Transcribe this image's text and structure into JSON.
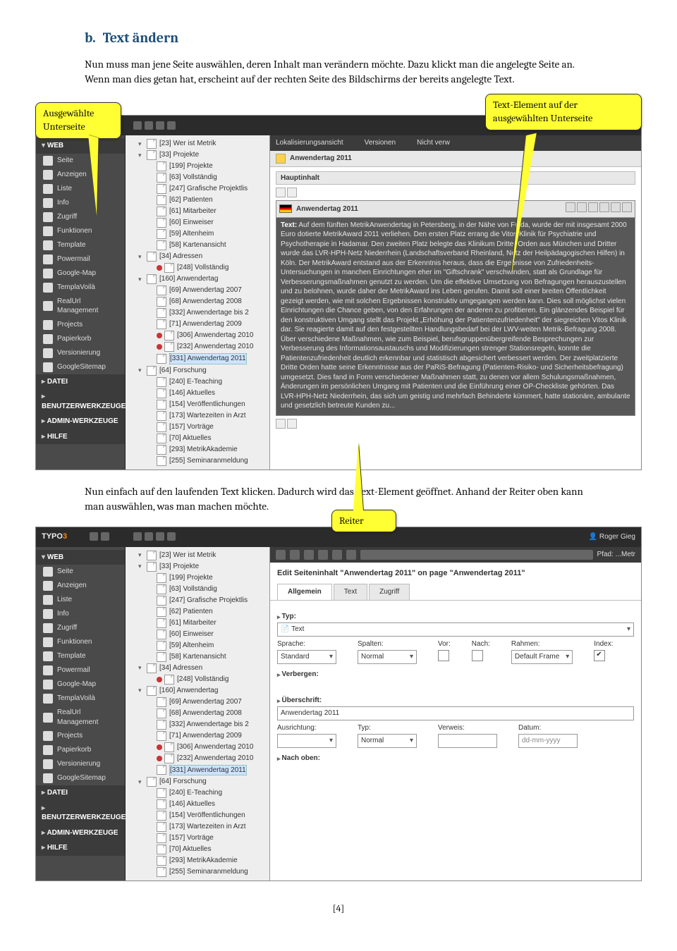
{
  "doc": {
    "heading_prefix": "b.",
    "heading": "Text ändern",
    "intro": "Nun muss man jene Seite auswählen, deren Inhalt man verändern möchte. Dazu klickt man die angelegte Seite an. Wenn man dies getan hat, erscheint auf der rechten Seite des Bildschirms der bereits angelegte Text.",
    "para2": "Nun einfach auf den laufenden Text klicken. Dadurch wird das Text-Element geöffnet. Anhand der Reiter oben kann man auswählen, was man machen möchte.",
    "page_num": "[4]"
  },
  "callouts": {
    "left": "Ausgewählte Unterseite",
    "right": "Text-Element auf der ausgewählten Unterseite",
    "reiter": "Reiter"
  },
  "shared": {
    "logo_a": "TYPO",
    "logo_b": "3",
    "user": "Roger Gieg",
    "web_group": "WEB",
    "modules": [
      "Seite",
      "Anzeigen",
      "Liste",
      "Info",
      "Zugriff",
      "Funktionen",
      "Template",
      "Powermail",
      "Google-Map",
      "TemplaVoilà",
      "RealUrl Management",
      "Projects",
      "Papierkorb",
      "Versionierung",
      "GoogleSitemap"
    ],
    "other_groups": [
      "DATEI",
      "BENUTZERWERKZEUGE",
      "ADMIN-WERKZEUGE",
      "HILFE"
    ],
    "tree": [
      {
        "lvl": 1,
        "exp": "▾",
        "lbl": "[23] Wer ist Metrik"
      },
      {
        "lvl": 1,
        "exp": "▾",
        "lbl": "[33] Projekte"
      },
      {
        "lvl": 2,
        "lbl": "[199] Projekte"
      },
      {
        "lvl": 2,
        "lbl": "[63] Vollständig"
      },
      {
        "lvl": 2,
        "lbl": "[247] Grafische Projektlis"
      },
      {
        "lvl": 2,
        "lbl": "[62] Patienten"
      },
      {
        "lvl": 2,
        "lbl": "[61] Mitarbeiter"
      },
      {
        "lvl": 2,
        "lbl": "[60] Einweiser"
      },
      {
        "lvl": 2,
        "lbl": "[59] Altenheim"
      },
      {
        "lvl": 2,
        "lbl": "[58] Kartenansicht"
      },
      {
        "lvl": 1,
        "exp": "▾",
        "lbl": "[34] Adressen"
      },
      {
        "lvl": 2,
        "dot": true,
        "lbl": "[248] Vollständig"
      },
      {
        "lvl": 1,
        "exp": "▾",
        "lbl": "[160] Anwendertag"
      },
      {
        "lvl": 2,
        "lbl": "[69] Anwendertag 2007"
      },
      {
        "lvl": 2,
        "lbl": "[68] Anwendertag 2008"
      },
      {
        "lvl": 2,
        "lbl": "[332] Anwendertage bis 2"
      },
      {
        "lvl": 2,
        "lbl": "[71] Anwendertag 2009"
      },
      {
        "lvl": 2,
        "dot": true,
        "lbl": "[306] Anwendertag 2010"
      },
      {
        "lvl": 2,
        "dot": true,
        "lbl": "[232] Anwendertag 2010"
      },
      {
        "lvl": 2,
        "sel": true,
        "lbl": "[331] Anwendertag 2011"
      },
      {
        "lvl": 1,
        "exp": "▾",
        "lbl": "[64] Forschung"
      },
      {
        "lvl": 2,
        "lbl": "[240] E-Teaching"
      },
      {
        "lvl": 2,
        "lbl": "[146] Aktuelles"
      },
      {
        "lvl": 2,
        "lbl": "[154] Veröffentlichungen"
      },
      {
        "lvl": 2,
        "lbl": "[173] Wartezeiten in Arzt"
      },
      {
        "lvl": 2,
        "lbl": "[157] Vorträge"
      },
      {
        "lvl": 2,
        "lbl": "[70] Aktuelles"
      },
      {
        "lvl": 2,
        "lbl": "[293] MetrikAkademie"
      },
      {
        "lvl": 2,
        "lbl": "[255] Seminaranmeldung"
      }
    ]
  },
  "fig1": {
    "path_tabs": [
      "Lokalisierungsansicht",
      "Versionen",
      "Nicht verw"
    ],
    "breadcrumb": "Anwendertag 2011",
    "maincol_header": "Hauptinhalt",
    "ce_title": "Anwendertag 2011",
    "ce_label": "Text:",
    "ce_text": "Auf dem fünften MetrikAnwendertag in Petersberg, in der Nähe von Fulda, wurde der mit insgesamt 2000 Euro dotierte MetrikAward 2011 verliehen. Den ersten Platz errang die Vitos Klinik für Psychiatrie und Psychotherapie in Hadamar. Den zweiten Platz belegte das Klinikum Dritter Orden aus München und Dritter wurde das LVR-HPH-Netz Niederrhein (Landschaftsverband Rheinland, Netz der Heilpädagogischen Hilfen) in Köln. Der MetrikAward entstand aus der Erkenntnis heraus, dass die Ergebnisse von Zufriedenheits-Untersuchungen in manchen Einrichtungen eher im \"Giftschrank\" verschwinden, statt als Grundlage für Verbesserungsmaßnahmen genutzt zu werden. Um die effektive Umsetzung von Befragungen herauszustellen und zu belohnen, wurde daher der MetrikAward ins Leben gerufen. Damit soll einer breiten Öffentlichkeit gezeigt werden, wie mit solchen Ergebnissen konstruktiv umgegangen werden kann. Dies soll möglichst vielen Einrichtungen die Chance geben, von den Erfahrungen der anderen zu profitieren. Ein glänzendes Beispiel für den konstruktiven Umgang stellt das Projekt „Erhöhung der Patientenzufriedenheit\" der siegreichen Vitos Klinik dar. Sie reagierte damit auf den festgestellten Handlungsbedarf bei der LWV-weiten Metrik-Befragung 2008. Über verschiedene Maßnahmen, wie zum Beispiel, berufsgruppenübergreifende Besprechungen zur Verbesserung des Informationsaustauschs und Modifizierungen strenger Stationsregeln, konnte die Patientenzufriedenheit deutlich erkennbar und statistisch abgesichert verbessert werden. Der zweitplatzierte Dritte Orden hatte seine Erkenntnisse aus der PaRiS-Befragung (Patienten-Risiko- und Sicherheitsbefragung) umgesetzt. Dies fand in Form verschiedener Maßnahmen statt, zu denen vor allem Schulungsmaßnahmen, Änderungen im persönlichen Umgang mit Patienten und die Einführung einer OP-Checkliste gehörten. Das LVR-HPH-Netz Niederrhein, das sich um geistig und mehrfach Behinderte kümmert, hatte stationäre, ambulante und gesetzlich betreute Kunden    zu..."
  },
  "fig2": {
    "pathlabel": "Pfad:  ...Metr",
    "edit_title": "Edit Seiteninhalt \"Anwendertag 2011\" on page \"Anwendertag 2011\"",
    "tabs": [
      "Allgemein",
      "Text",
      "Zugriff"
    ],
    "typ_label": "Typ:",
    "typ_value": "Text",
    "row_fields": {
      "sprache": {
        "label": "Sprache:",
        "value": "Standard"
      },
      "spalten": {
        "label": "Spalten:",
        "value": "Normal"
      },
      "vor": {
        "label": "Vor:"
      },
      "nach": {
        "label": "Nach:"
      },
      "rahmen": {
        "label": "Rahmen:",
        "value": "Default Frame"
      },
      "index": {
        "label": "Index:",
        "checked": true
      }
    },
    "verbergen": "Verbergen:",
    "ueberschrift": "Überschrift:",
    "ueberschrift_value": "Anwendertag 2011",
    "row2": {
      "ausrichtung": {
        "label": "Ausrichtung:"
      },
      "typ": {
        "label": "Typ:",
        "value": "Normal"
      },
      "verweis": {
        "label": "Verweis:"
      },
      "datum": {
        "label": "Datum:",
        "placeholder": "dd-mm-yyyy"
      }
    },
    "nachoben": "Nach oben:"
  }
}
